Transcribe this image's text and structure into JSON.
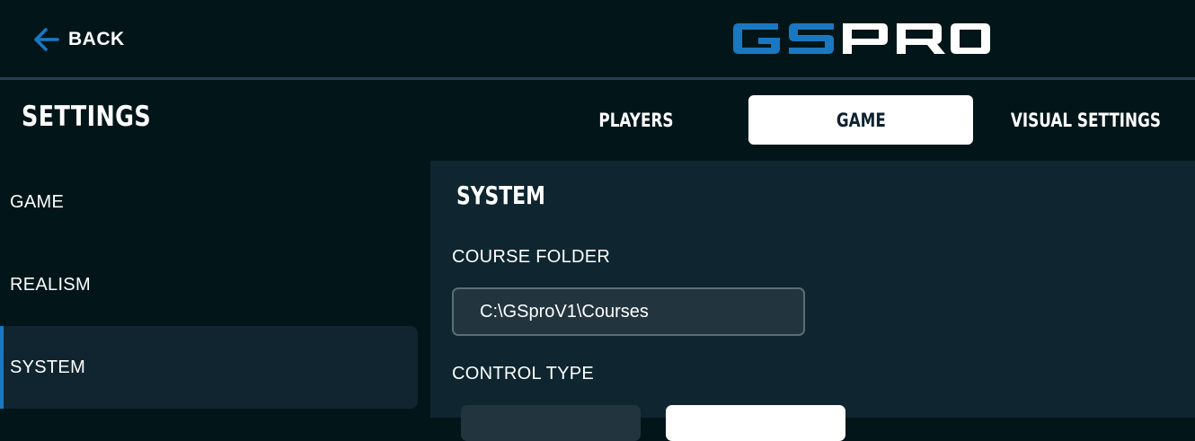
{
  "header": {
    "back_label": "BACK",
    "logo_text": "GSPRO",
    "logo_colors": {
      "gs": "#1a78c2",
      "pro": "#ffffff"
    },
    "accent_color": "#1a78c2"
  },
  "page": {
    "title": "SETTINGS"
  },
  "tabs": [
    {
      "label": "PLAYERS",
      "active": false
    },
    {
      "label": "GAME",
      "active": true
    },
    {
      "label": "VISUAL SETTINGS",
      "active": false
    }
  ],
  "sidebar": {
    "items": [
      {
        "label": "GAME",
        "selected": false
      },
      {
        "label": "REALISM",
        "selected": false
      },
      {
        "label": "SYSTEM",
        "selected": true
      }
    ]
  },
  "content": {
    "section_title": "SYSTEM",
    "course_folder": {
      "label": "COURSE FOLDER",
      "value": "C:\\GSproV1\\Courses"
    },
    "control_type": {
      "label": "CONTROL TYPE"
    }
  },
  "icons": {
    "back": "arrow-left-icon"
  }
}
